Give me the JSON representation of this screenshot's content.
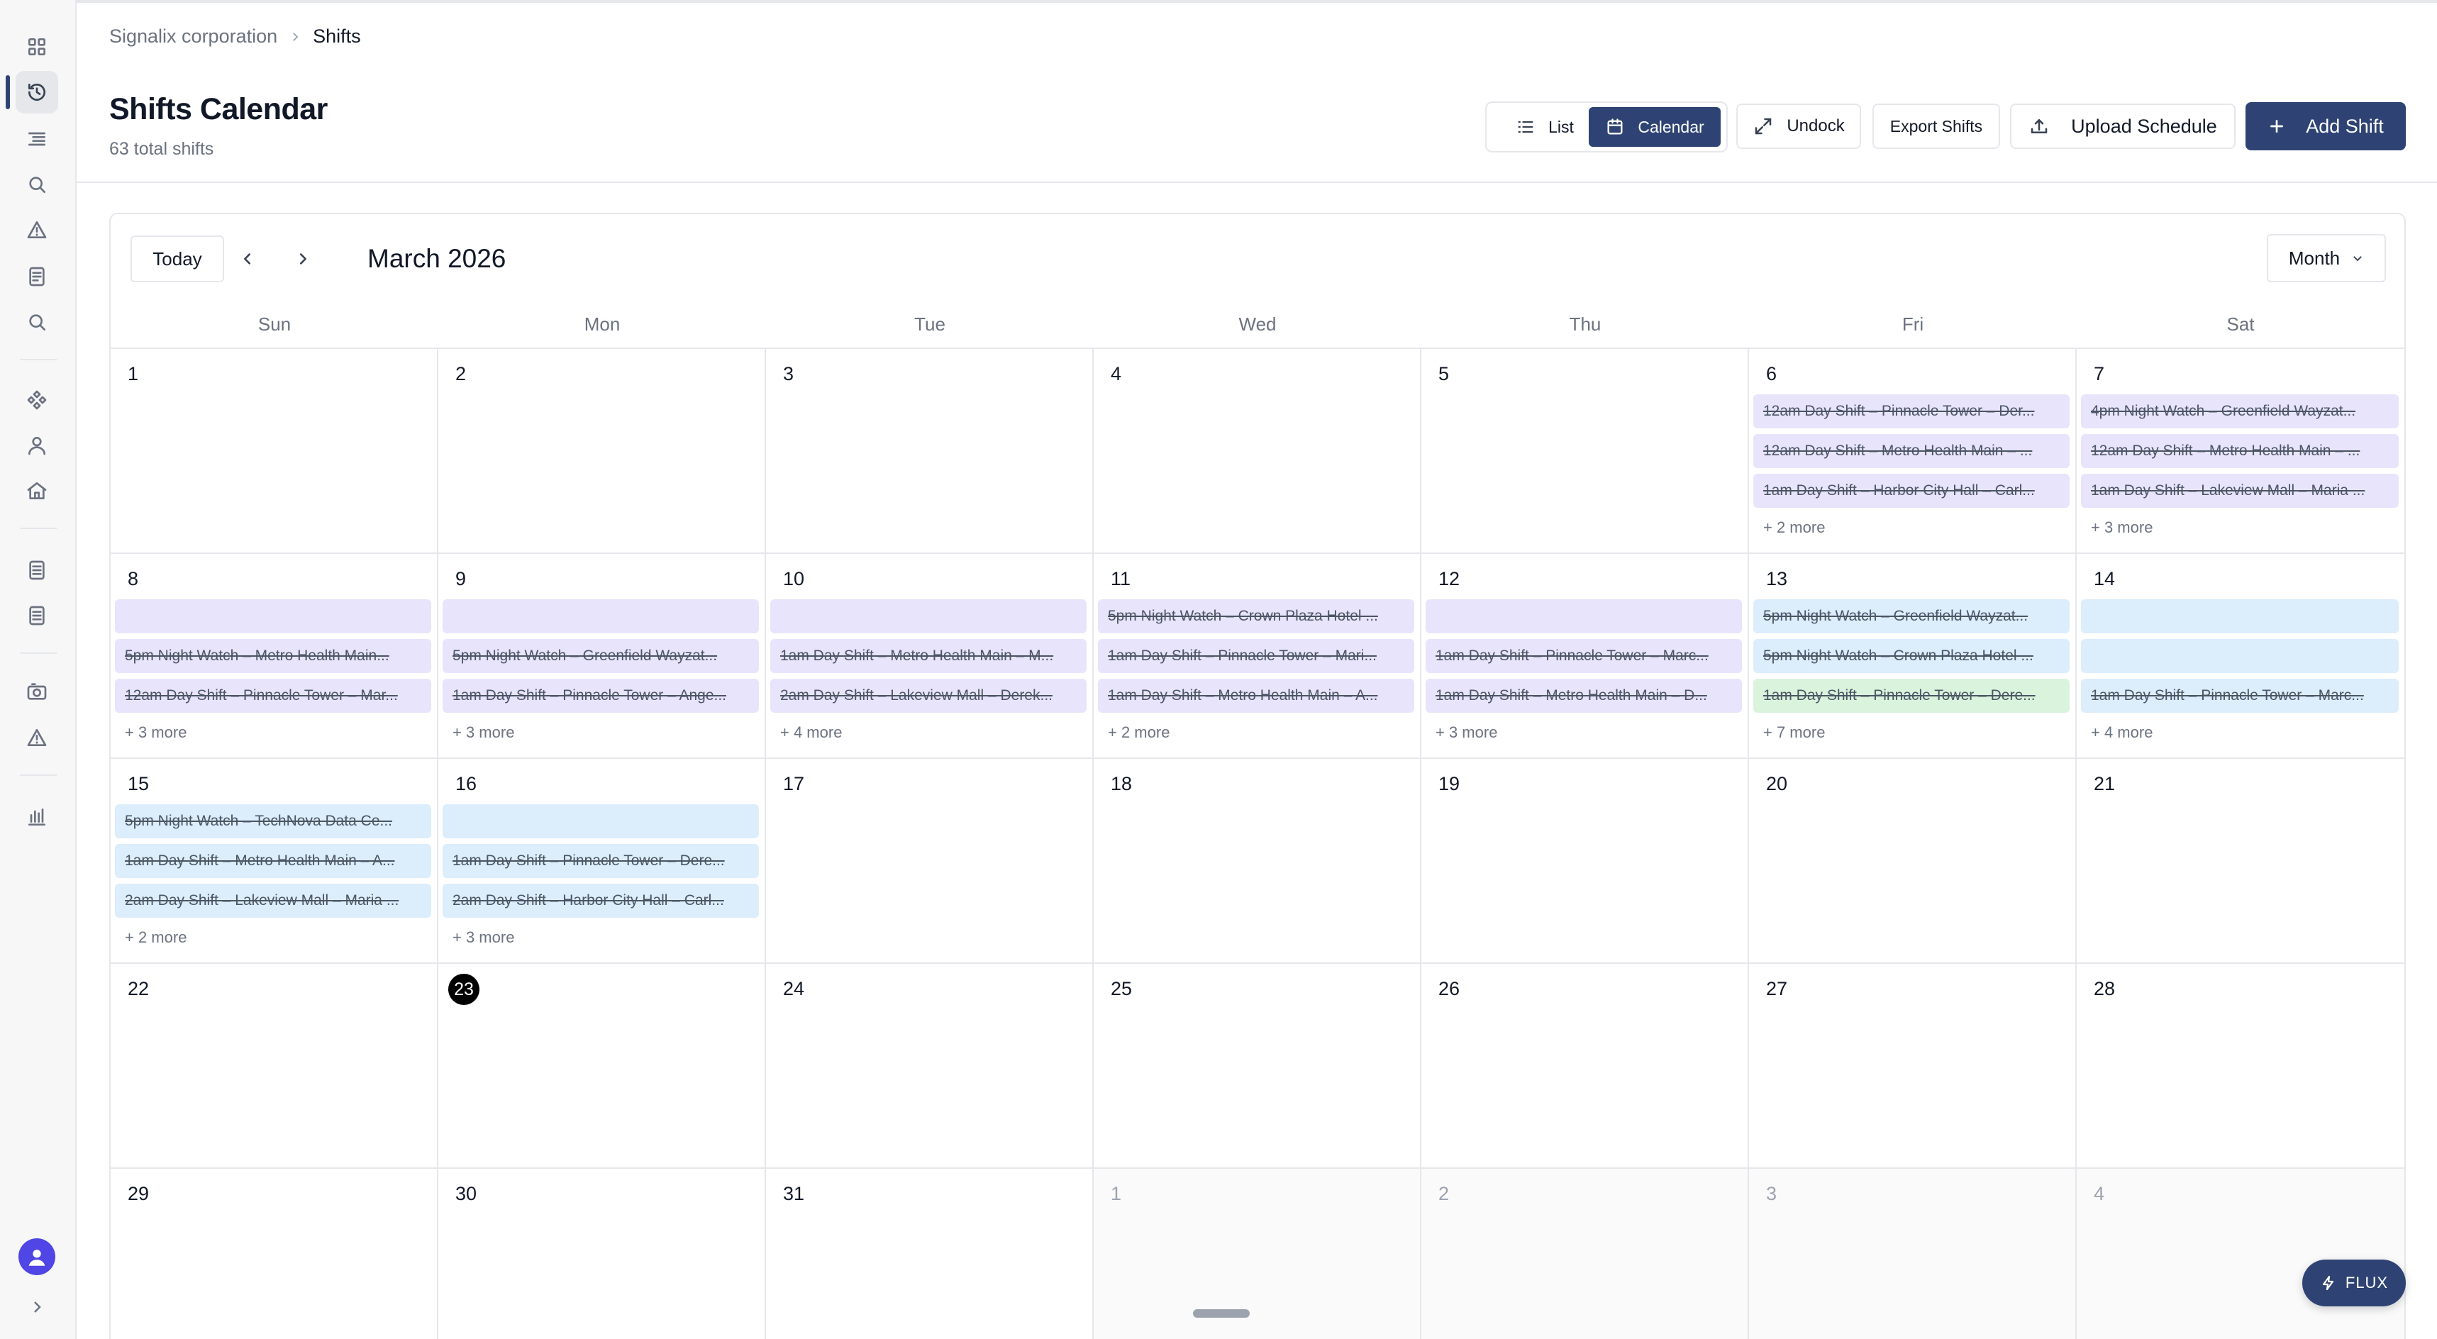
{
  "breadcrumb": {
    "org": "Signalix corporation",
    "current": "Shifts"
  },
  "page": {
    "title": "Shifts Calendar",
    "subtitle": "63 total shifts"
  },
  "toolbar": {
    "list_label": "List",
    "calendar_label": "Calendar",
    "undock_label": "Undock",
    "export_label": "Export Shifts",
    "upload_label": "Upload Schedule",
    "add_label": "Add Shift"
  },
  "calendar": {
    "today_label": "Today",
    "month_label": "March 2026",
    "view_label": "Month",
    "weekdays": [
      "Sun",
      "Mon",
      "Tue",
      "Wed",
      "Thu",
      "Fri",
      "Sat"
    ],
    "weeks": [
      [
        {
          "num": "1",
          "shifts": [],
          "more": ""
        },
        {
          "num": "2",
          "shifts": [],
          "more": ""
        },
        {
          "num": "3",
          "shifts": [],
          "more": ""
        },
        {
          "num": "4",
          "shifts": [],
          "more": ""
        },
        {
          "num": "5",
          "shifts": [],
          "more": ""
        },
        {
          "num": "6",
          "shifts": [
            {
              "text": "12am Day Shift – Pinnacle Tower – Der...",
              "color": "purple"
            },
            {
              "text": "12am Day Shift – Metro Health Main – ...",
              "color": "purple"
            },
            {
              "text": "1am Day Shift – Harbor City Hall – Carl...",
              "color": "purple"
            }
          ],
          "more": "+ 2 more"
        },
        {
          "num": "7",
          "shifts": [
            {
              "text": "4pm Night Watch – Greenfield Wayzat...",
              "color": "purple"
            },
            {
              "text": "12am Day Shift – Metro Health Main – ...",
              "color": "purple"
            },
            {
              "text": "1am Day Shift – Lakeview Mall – Maria ...",
              "color": "purple"
            }
          ],
          "more": "+ 3 more"
        }
      ],
      [
        {
          "num": "8",
          "shifts": [
            {
              "text": "",
              "color": "purple"
            },
            {
              "text": "5pm Night Watch – Metro Health Main...",
              "color": "purple"
            },
            {
              "text": "12am Day Shift – Pinnacle Tower – Mar...",
              "color": "purple"
            }
          ],
          "more": "+ 3 more"
        },
        {
          "num": "9",
          "shifts": [
            {
              "text": "",
              "color": "purple"
            },
            {
              "text": "5pm Night Watch – Greenfield Wayzat...",
              "color": "purple"
            },
            {
              "text": "1am Day Shift – Pinnacle Tower – Ange...",
              "color": "purple"
            }
          ],
          "more": "+ 3 more"
        },
        {
          "num": "10",
          "shifts": [
            {
              "text": "",
              "color": "purple"
            },
            {
              "text": "1am Day Shift – Metro Health Main – M...",
              "color": "purple"
            },
            {
              "text": "2am Day Shift – Lakeview Mall – Derek...",
              "color": "purple"
            }
          ],
          "more": "+ 4 more"
        },
        {
          "num": "11",
          "shifts": [
            {
              "text": "5pm Night Watch – Crown Plaza Hotel ...",
              "color": "purple"
            },
            {
              "text": "1am Day Shift – Pinnacle Tower – Mari...",
              "color": "purple"
            },
            {
              "text": "1am Day Shift – Metro Health Main – A...",
              "color": "purple"
            }
          ],
          "more": "+ 2 more"
        },
        {
          "num": "12",
          "shifts": [
            {
              "text": "",
              "color": "purple"
            },
            {
              "text": "1am Day Shift – Pinnacle Tower – Marc...",
              "color": "purple"
            },
            {
              "text": "1am Day Shift – Metro Health Main – D...",
              "color": "purple"
            }
          ],
          "more": "+ 3 more"
        },
        {
          "num": "13",
          "shifts": [
            {
              "text": "5pm Night Watch – Greenfield Wayzat...",
              "color": "blue"
            },
            {
              "text": "5pm Night Watch – Crown Plaza Hotel ...",
              "color": "blue"
            },
            {
              "text": "1am Day Shift – Pinnacle Tower – Dere...",
              "color": "green"
            }
          ],
          "more": "+ 7 more"
        },
        {
          "num": "14",
          "shifts": [
            {
              "text": "",
              "color": "blue"
            },
            {
              "text": "",
              "color": "blue"
            },
            {
              "text": "1am Day Shift – Pinnacle Tower – Marc...",
              "color": "blue"
            }
          ],
          "more": "+ 4 more"
        }
      ],
      [
        {
          "num": "15",
          "shifts": [
            {
              "text": "5pm Night Watch – TechNova Data Ce...",
              "color": "blue"
            },
            {
              "text": "1am Day Shift – Metro Health Main – A...",
              "color": "blue"
            },
            {
              "text": "2am Day Shift – Lakeview Mall – Maria ...",
              "color": "blue"
            }
          ],
          "more": "+ 2 more"
        },
        {
          "num": "16",
          "shifts": [
            {
              "text": "",
              "color": "blue"
            },
            {
              "text": "1am Day Shift – Pinnacle Tower – Dere...",
              "color": "blue"
            },
            {
              "text": "2am Day Shift – Harbor City Hall – Carl...",
              "color": "blue"
            }
          ],
          "more": "+ 3 more"
        },
        {
          "num": "17",
          "shifts": [],
          "more": ""
        },
        {
          "num": "18",
          "shifts": [],
          "more": ""
        },
        {
          "num": "19",
          "shifts": [],
          "more": ""
        },
        {
          "num": "20",
          "shifts": [],
          "more": ""
        },
        {
          "num": "21",
          "shifts": [],
          "more": ""
        }
      ],
      [
        {
          "num": "22",
          "shifts": [],
          "more": ""
        },
        {
          "num": "23",
          "shifts": [],
          "more": "",
          "today": true
        },
        {
          "num": "24",
          "shifts": [],
          "more": ""
        },
        {
          "num": "25",
          "shifts": [],
          "more": ""
        },
        {
          "num": "26",
          "shifts": [],
          "more": ""
        },
        {
          "num": "27",
          "shifts": [],
          "more": ""
        },
        {
          "num": "28",
          "shifts": [],
          "more": ""
        }
      ],
      [
        {
          "num": "29",
          "shifts": [],
          "more": ""
        },
        {
          "num": "30",
          "shifts": [],
          "more": ""
        },
        {
          "num": "31",
          "shifts": [],
          "more": ""
        },
        {
          "num": "1",
          "shifts": [],
          "more": "",
          "outside": true
        },
        {
          "num": "2",
          "shifts": [],
          "more": "",
          "outside": true
        },
        {
          "num": "3",
          "shifts": [],
          "more": "",
          "outside": true
        },
        {
          "num": "4",
          "shifts": [],
          "more": "",
          "outside": true
        }
      ]
    ]
  },
  "flux": {
    "label": "FLUX"
  },
  "sidebar_icons": [
    "dashboard-icon",
    "clock-icon",
    "list-icon",
    "search-icon",
    "alert-icon",
    "document-icon",
    "search-icon",
    "diamond-grid-icon",
    "user-icon",
    "home-icon",
    "report-icon",
    "report-icon",
    "camera-icon",
    "alert-icon",
    "bar-chart-icon"
  ],
  "colors": {
    "accent": "#2e4374",
    "shift_purple": "#e8e4fb",
    "shift_blue": "#dcedfb",
    "shift_green": "#d9f3dd"
  }
}
